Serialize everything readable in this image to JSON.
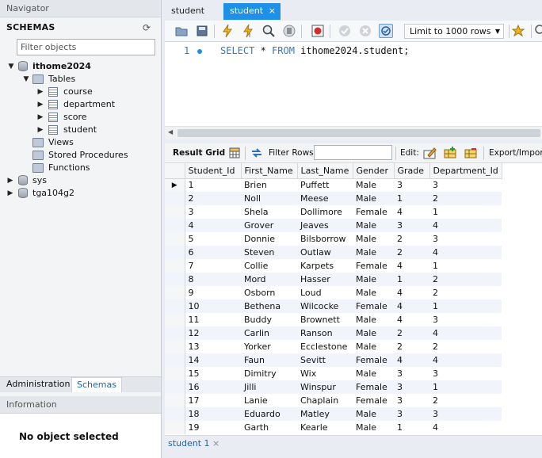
{
  "navigator": {
    "title": "Navigator",
    "schemas_label": "SCHEMAS",
    "filter_placeholder": "Filter objects",
    "tree": {
      "db_main": "ithome2024",
      "tables": "Tables",
      "table_items": [
        "course",
        "department",
        "score",
        "student"
      ],
      "views": "Views",
      "stored_procedures": "Stored Procedures",
      "functions": "Functions",
      "db_sys": "sys",
      "db_other": "tga104g2"
    },
    "bottom_tabs": {
      "administration": "Administration",
      "schemas": "Schemas"
    },
    "information": {
      "title": "Information",
      "empty": "No object selected"
    }
  },
  "editor_tabs": [
    {
      "label": "student"
    },
    {
      "label": "student",
      "active": true,
      "close": "×"
    }
  ],
  "toolbar": {
    "limit_select": "Limit to 1000 rows"
  },
  "editor": {
    "line_number": "1",
    "sql": {
      "kw1": "SELECT",
      "star": " * ",
      "kw2": "FROM",
      "rest": " ithome2024.student;"
    }
  },
  "result_toolbar": {
    "result_grid": "Result Grid",
    "filter_rows": "Filter Rows:",
    "edit": "Edit:",
    "export": "Export/Import"
  },
  "result_grid": {
    "columns": [
      "Student_Id",
      "First_Name",
      "Last_Name",
      "Gender",
      "Grade",
      "Department_Id"
    ],
    "rows": [
      [
        "1",
        "Brien",
        "Puffett",
        "Male",
        "3",
        "3"
      ],
      [
        "2",
        "Noll",
        "Meese",
        "Male",
        "1",
        "2"
      ],
      [
        "3",
        "Shela",
        "Dollimore",
        "Female",
        "4",
        "1"
      ],
      [
        "4",
        "Grover",
        "Jeaves",
        "Male",
        "3",
        "4"
      ],
      [
        "5",
        "Donnie",
        "Bilsborrow",
        "Male",
        "2",
        "3"
      ],
      [
        "6",
        "Steven",
        "Outlaw",
        "Male",
        "2",
        "4"
      ],
      [
        "7",
        "Collie",
        "Karpets",
        "Female",
        "4",
        "1"
      ],
      [
        "8",
        "Mord",
        "Hasser",
        "Male",
        "1",
        "2"
      ],
      [
        "9",
        "Osborn",
        "Loud",
        "Male",
        "4",
        "2"
      ],
      [
        "10",
        "Bethena",
        "Wilcocke",
        "Female",
        "4",
        "1"
      ],
      [
        "11",
        "Buddy",
        "Brownett",
        "Male",
        "4",
        "3"
      ],
      [
        "12",
        "Carlin",
        "Ranson",
        "Male",
        "2",
        "4"
      ],
      [
        "13",
        "Yorker",
        "Ecclestone",
        "Male",
        "2",
        "2"
      ],
      [
        "14",
        "Faun",
        "Sevitt",
        "Female",
        "4",
        "4"
      ],
      [
        "15",
        "Dimitry",
        "Wix",
        "Male",
        "3",
        "3"
      ],
      [
        "16",
        "Jilli",
        "Winspur",
        "Female",
        "3",
        "1"
      ],
      [
        "17",
        "Lanie",
        "Chaplain",
        "Female",
        "3",
        "2"
      ],
      [
        "18",
        "Eduardo",
        "Matley",
        "Male",
        "3",
        "3"
      ],
      [
        "19",
        "Garth",
        "Kearle",
        "Male",
        "1",
        "4"
      ]
    ]
  },
  "result_tabs": [
    {
      "label": "student 1",
      "close": "×"
    }
  ]
}
